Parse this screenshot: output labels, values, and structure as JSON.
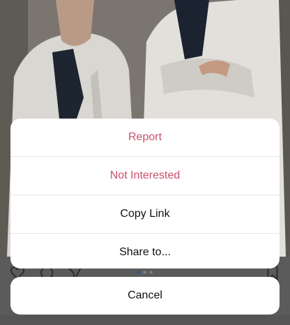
{
  "action_sheet": {
    "items": [
      {
        "label": "Report",
        "style": "destructive"
      },
      {
        "label": "Not Interested",
        "style": "destructive"
      },
      {
        "label": "Copy Link",
        "style": "default"
      },
      {
        "label": "Share to...",
        "style": "default"
      }
    ],
    "cancel_label": "Cancel"
  },
  "post": {
    "carousel_index": 1,
    "carousel_count": 3,
    "icons": [
      "heart-icon",
      "comment-icon",
      "share-icon",
      "bookmark-icon"
    ]
  },
  "colors": {
    "destructive": "#c9506b",
    "default_text": "#111111",
    "sheet_bg": "#ffffff",
    "carousel_active": "#2a5d8f"
  }
}
